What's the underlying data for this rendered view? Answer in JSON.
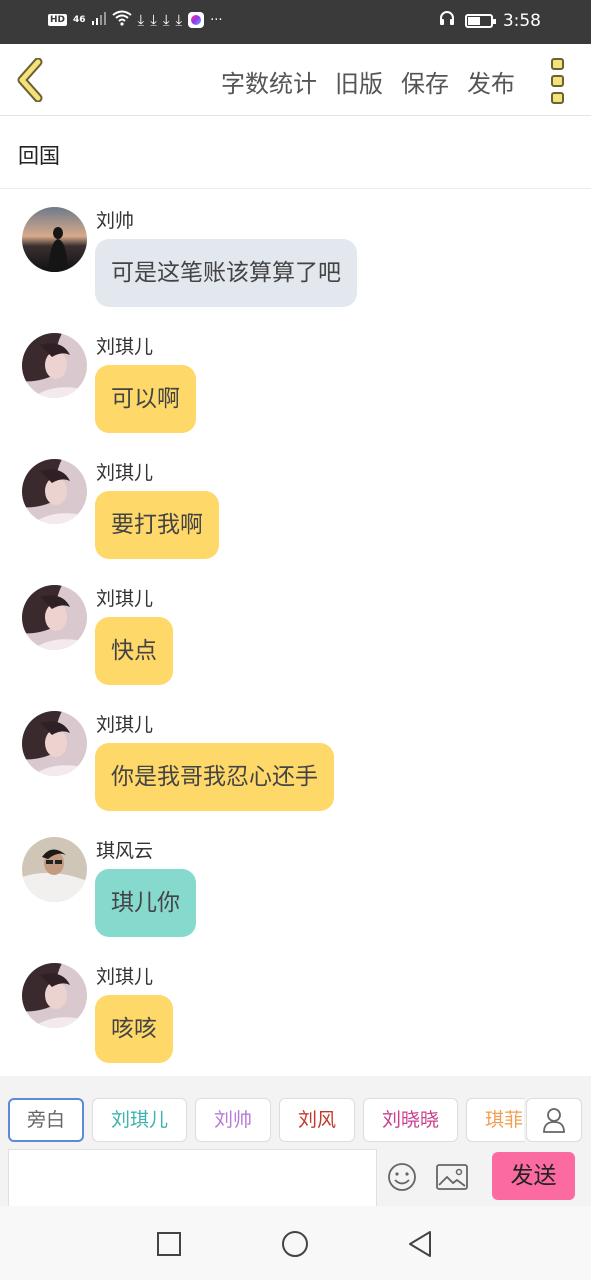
{
  "status_bar": {
    "hd": "HD",
    "network": "46",
    "time": "3:58"
  },
  "toolbar": {
    "actions": [
      "字数统计",
      "旧版",
      "保存",
      "发布"
    ]
  },
  "title": "回国",
  "messages": [
    {
      "name": "刘帅",
      "text": "可是这笔账该算算了吧",
      "bubble_color": "#e3e7ee"
    },
    {
      "name": "刘琪儿",
      "text": "可以啊",
      "bubble_color": "#ffd86a"
    },
    {
      "name": "刘琪儿",
      "text": "要打我啊",
      "bubble_color": "#ffd86a"
    },
    {
      "name": "刘琪儿",
      "text": "快点",
      "bubble_color": "#ffd86a"
    },
    {
      "name": "刘琪儿",
      "text": "你是我哥我忍心还手",
      "bubble_color": "#ffd86a"
    },
    {
      "name": "琪风云",
      "text": "琪儿你",
      "bubble_color": "#86d9cd"
    },
    {
      "name": "刘琪儿",
      "text": "咳咳",
      "bubble_color": "#ffd86a"
    }
  ],
  "roles": [
    {
      "label": "旁白",
      "color": "#666666"
    },
    {
      "label": "刘琪儿",
      "color": "#3bb4b0"
    },
    {
      "label": "刘帅",
      "color": "#b67bd6"
    },
    {
      "label": "刘风",
      "color": "#c0392b"
    },
    {
      "label": "刘晓晓",
      "color": "#cc3d8f"
    },
    {
      "label": "琪菲",
      "color": "#f0a050"
    }
  ],
  "composer": {
    "input_value": "",
    "send_label": "发送"
  }
}
